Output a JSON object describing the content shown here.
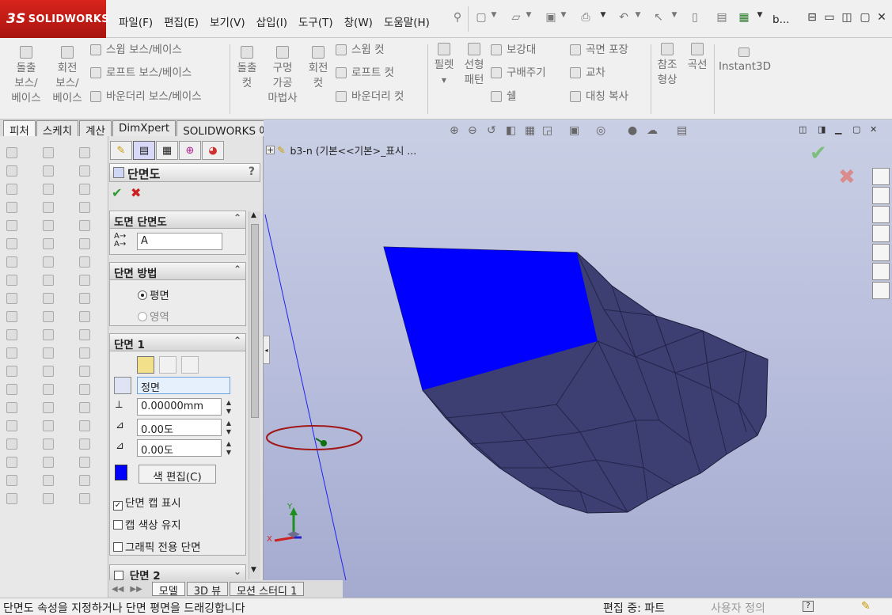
{
  "app": {
    "brand": "SOLIDWORKS",
    "brand_prefix": "3S",
    "doc_title": "b..."
  },
  "menu": [
    "파일(F)",
    "편집(E)",
    "보기(V)",
    "삽입(I)",
    "도구(T)",
    "창(W)",
    "도움말(H)"
  ],
  "features_toolbar": {
    "extrude_boss_lines": [
      "돌출",
      "보스/",
      "베이스"
    ],
    "revolve_boss_lines": [
      "회전",
      "보스/",
      "베이스"
    ],
    "sweep_boss": "스윕 보스/베이스",
    "loft_boss": "로프트 보스/베이스",
    "boundary_boss": "바운더리 보스/베이스",
    "extrude_cut_lines": [
      "돌출",
      "컷"
    ],
    "hole_wizard_lines": [
      "구멍",
      "가공",
      "마법사"
    ],
    "revolve_cut_lines": [
      "회전",
      "컷"
    ],
    "sweep_cut": "스윕 컷",
    "loft_cut": "로프트 컷",
    "boundary_cut": "바운더리 컷",
    "fillet": "필렛",
    "linear_pattern_lines": [
      "선형",
      "패턴"
    ],
    "rib": "보강대",
    "draft": "구배주기",
    "shell": "쉘",
    "wrap": "곡면 포장",
    "intersect": "교차",
    "mirror": "대칭 복사",
    "ref_geometry_lines": [
      "참조",
      "형상"
    ],
    "curves": "곡선",
    "instant3d": "Instant3D"
  },
  "command_tabs": [
    {
      "label": "피처",
      "active": true
    },
    {
      "label": "스케치",
      "active": false
    },
    {
      "label": "계산",
      "active": false
    },
    {
      "label": "DimXpert",
      "active": false
    },
    {
      "label": "SOLIDWORKS 애드인",
      "active": false
    }
  ],
  "tree_node": "b3-n  (기본<<기본>_표시 ...",
  "panel": {
    "title": "단면도",
    "help": "?",
    "drawing_section": {
      "title": "도면 단면도",
      "label_value": "A"
    },
    "method": {
      "title": "단면 방법",
      "options": [
        {
          "label": "평면",
          "selected": true,
          "enabled": true
        },
        {
          "label": "영역",
          "selected": false,
          "enabled": false
        }
      ]
    },
    "section1": {
      "title": "단면 1",
      "plane": "정면",
      "offset": "0.00000mm",
      "angle_x": "0.00도",
      "angle_y": "0.00도",
      "color_button": "색 편집(C)",
      "section_color": "#0000ff",
      "show_cap": {
        "label": "단면 캡 표시",
        "checked": true
      },
      "keep_cap_color": {
        "label": "캡 색상 유지",
        "checked": false
      },
      "graphics_only": {
        "label": "그래픽 전용 단면",
        "checked": false
      }
    },
    "section2": {
      "title": "단면 2",
      "checked": false
    }
  },
  "bottom_tabs": [
    "모델",
    "3D 뷰",
    "모션 스터디 1"
  ],
  "status": {
    "message": "단면도 속성을 지정하거나 단면 평면을 드래깅합니다",
    "mode": "편집 중: 파트",
    "custom": "사용자 정의"
  },
  "triad": {
    "x": "X",
    "y": "Y"
  },
  "colors": {
    "section_cap": "#0000ff",
    "mesh": "#3d3f72",
    "accept": "#2e9b2e",
    "cancel": "#cc1f1f"
  }
}
